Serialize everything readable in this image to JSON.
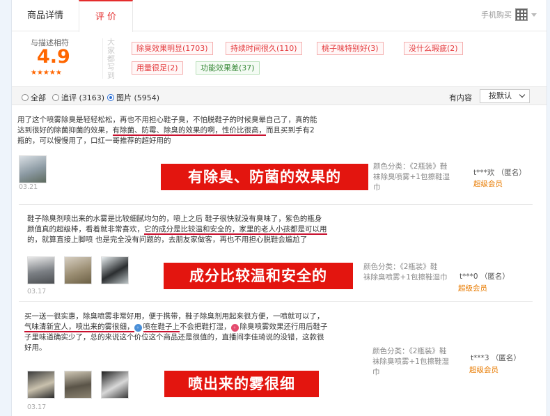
{
  "tabs": {
    "details": "商品详情",
    "reviews": "评 价",
    "mobile_buy": "手机购买"
  },
  "summary": {
    "match_label": "与描述相符",
    "score": "4.9",
    "stars": "★★★★★",
    "impressions_label": "大家都写到",
    "tags": [
      {
        "text": "除臭效果明显(1703)"
      },
      {
        "text": "持续时间很久(110)"
      },
      {
        "text": "桃子味特别好(3)"
      },
      {
        "text": "没什么瑕疵(2)"
      },
      {
        "text": "用量很足(2)"
      },
      {
        "text": "功能效果差(37)"
      }
    ]
  },
  "filter": {
    "all": "全部",
    "followup": "追评 (3163)",
    "images": "图片 (5954)",
    "has_content": "有内容",
    "sort": "按默认"
  },
  "reviews": [
    {
      "lines": [
        "用了这个喷雾除臭是轻轻松松，再也不用担心鞋子臭，不怕脱鞋子的时候臭晕自己了，真的能",
        "达到很好的除菌抑菌的效果，",
        "有除菌、防霉、除臭的效果的啊，性价比很高，",
        "而且买到手有2",
        "瓶的，可以慢慢用了，口红一哥推荐的超好用的"
      ],
      "date": "03.21",
      "spec": "颜色分类：《2瓶装》鞋",
      "spec2": "袜除臭喷雾+1包擦鞋湿",
      "spec3": "巾",
      "user": "t***欢 （匿名）",
      "level": "超级会员",
      "banner": "有除臭、防菌的效果的"
    },
    {
      "lines": [
        "鞋子除臭剂喷出来的水雾是比较细腻均匀的，喷上之后 鞋子很快就没有臭味了，紫色的瓶身",
        "颜值真的超级棒，看着就非常喜欢，",
        "它的成分是比较温和安全的，家里的老人小孩都是可以用",
        "的，就算直接上脚喷 也是完全没有问题的，去朋友家做客，再也不用担心脱鞋会尴尬了"
      ],
      "date": "03.17",
      "spec": "颜色分类：《2瓶装》鞋",
      "spec2": "袜除臭喷雾+1包擦鞋湿巾",
      "user": "t***0 （匿名）",
      "level": "超级会员",
      "banner": "成分比较温和安全的"
    },
    {
      "lines": [
        "买一送一很实惠，除臭喷雾非常好用，便于携带，鞋子除臭剂用起来很方便，一喷就可以了，",
        "气味清新宜人，喷出来的雾很细，",
        "喷在鞋子上",
        "不会把鞋打湿，",
        "除臭喷雾效果还行用后鞋子",
        "子里味道确实少了，总的来说这个价位这个商品还是很值的，直播间李佳琦说的没错，这款很",
        "好用。"
      ],
      "date": "03.17",
      "spec": "颜色分类：《2瓶装》鞋",
      "spec2": "袜除臭喷雾+1包擦鞋湿",
      "spec3": "巾",
      "user": "t***3 （匿名）",
      "level": "超级会员",
      "banner": "喷出来的雾很细"
    }
  ],
  "colors": {
    "accent": "#e42c2c",
    "score": "#ff6600",
    "banner": "#e3150f",
    "level": "#e87b00"
  }
}
